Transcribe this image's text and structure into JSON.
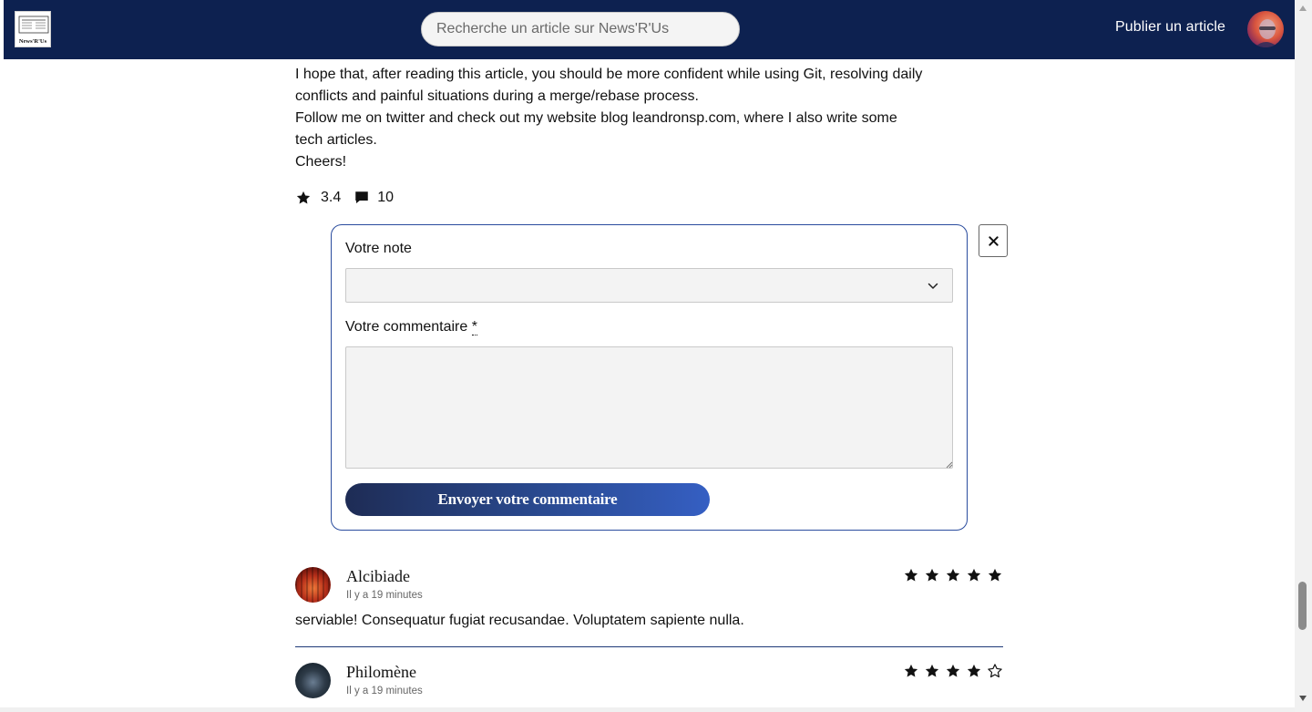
{
  "header": {
    "logo_text": "News'R'Us",
    "search_placeholder": "Recherche un article sur News'R'Us",
    "publish_label": "Publier un article"
  },
  "article": {
    "paragraphs": [
      "I hope that, after reading this article, you should be more confident while using Git, resolving daily",
      "conflicts and painful situations during a merge/rebase process.",
      "Follow me on twitter and check out my website blog leandronsp.com, where I also write some",
      "tech articles.",
      "Cheers!"
    ],
    "rating": "3.4",
    "comment_count": "10"
  },
  "form": {
    "note_label": "Votre note",
    "note_value": "",
    "comment_label": "Votre commentaire",
    "required_mark": "*",
    "comment_value": "",
    "submit_label": "Envoyer votre commentaire"
  },
  "comments": [
    {
      "author": "Alcibiade",
      "time": "Il y a 19 minutes",
      "rating": 5,
      "text": "serviable! Consequatur fugiat recusandae. Voluptatem sapiente nulla."
    },
    {
      "author": "Philomène",
      "time": "Il y a 19 minutes",
      "rating": 4,
      "text": ""
    }
  ],
  "colors": {
    "header_bg": "#0d2150",
    "accent": "#2a4c9e",
    "button_gradient_start": "#1e2c55",
    "button_gradient_end": "#355fc3"
  },
  "icons": {
    "rating": "star-icon",
    "comments": "speech-bubble-icon",
    "close": "close-icon",
    "select": "chevron-down-icon"
  }
}
